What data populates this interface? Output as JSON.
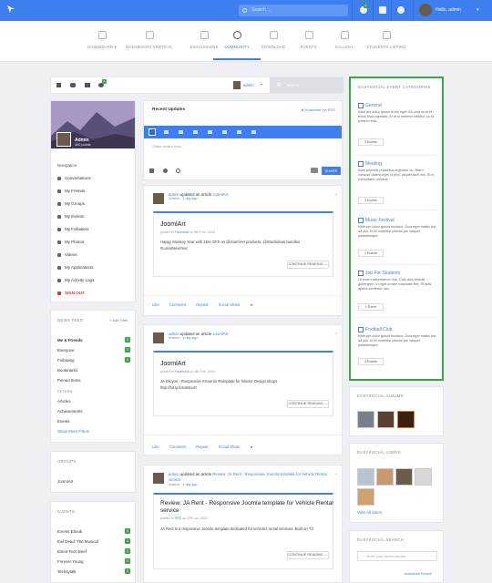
{
  "topbar": {
    "search_placeholder": "Search ...",
    "notif_count": "1",
    "user_greeting": "Hello, admin"
  },
  "nav": {
    "items": [
      {
        "label": "DASHBOARD",
        "arrow": "▾"
      },
      {
        "label": "DASHBOARD VERTICAL"
      },
      {
        "label": "DISCUSSIONS"
      },
      {
        "label": "COMMUNITY"
      },
      {
        "label": "DOWNLOAD"
      },
      {
        "label": "EVENTS"
      },
      {
        "label": "GALLERY"
      },
      {
        "label": "STUDENTS LISTING"
      }
    ]
  },
  "toolbar": {
    "user_label": "admin",
    "search_placeholder": "Search",
    "badge": "1"
  },
  "profile": {
    "name": "Admin",
    "points": "320 points",
    "nav_heading": "Navigation",
    "menu": [
      "Conversations",
      "My Friends",
      "My Groups",
      "My Events",
      "My Followers",
      "My Photos",
      "Videos",
      "My Applications",
      "My Activity Logs",
      "SIGN OUT"
    ]
  },
  "newsfeed": {
    "heading": "NEWS FEED",
    "add_filter": "+ Add Filter",
    "items": [
      {
        "label": "Me & Friends",
        "count": "0"
      },
      {
        "label": "Everyone",
        "count": "0"
      },
      {
        "label": "Following",
        "count": "0"
      },
      {
        "label": "Bookmarks",
        "count": ""
      },
      {
        "label": "Pinned Items",
        "count": ""
      }
    ],
    "filters_heading": "FILTERS:",
    "filters": [
      "Articles",
      "Achievements",
      "Events"
    ],
    "show_more": "Show More Filters"
  },
  "groups": {
    "heading": "GROUPS",
    "items": [
      "JoomlArt"
    ]
  },
  "events": {
    "heading": "EVENTS",
    "items": [
      {
        "label": "Events Ebook",
        "count": "0"
      },
      {
        "label": "Evil Dead: The Musical",
        "count": "0"
      },
      {
        "label": "Event Tech Brief",
        "count": "0"
      },
      {
        "label": "Forever Young",
        "count": "0"
      },
      {
        "label": "Techsytalk",
        "count": "0"
      }
    ]
  },
  "updates": {
    "title": "Recent Updates",
    "rss": "Subscribe via RSS",
    "composer_placeholder": "Share what's new...",
    "share_button": "SHARE"
  },
  "posts": [
    {
      "author": "admin",
      "verb": "updated an article",
      "target": "JoomlArt.",
      "category": "Articles",
      "time": "1 day ago",
      "title": "JoomlArt",
      "meta_prefix": "posted in",
      "meta_source": "Facebook",
      "meta_date": "on 5th Feb, 2016",
      "body": "Happy Monkey Year with 25% OFF on @JoomlArt products, @Stackideas bundles #LunarNewYear",
      "continue": "CONTINUE READING →",
      "actions": [
        "Like",
        "Comment",
        "Repost",
        "Social Share"
      ]
    },
    {
      "author": "admin",
      "verb": "updated an article",
      "target": "JoomlArt.",
      "category": "Articles",
      "time": "1 day ago",
      "title": "JoomlArt",
      "meta_prefix": "posted in",
      "meta_source": "Facebook",
      "meta_date": "on 5th Feb, 2016",
      "body": "JA Elicyon - Responsive #Joomla #template for Interior Design shops http://bit.ly/1mcBmuO",
      "continue": "CONTINUE READING →",
      "actions": [
        "Like",
        "Comment",
        "Repost",
        "Social Share"
      ]
    },
    {
      "author": "admin",
      "verb": "updated an article",
      "target": "Review: JA Rent - Responsive Joomla template for Vehicle Rental service",
      "category": "Articles",
      "time": "1 day ago",
      "title": "Review: JA Rent - Responsive Joomla template for Vehicle Rental service",
      "meta_prefix": "posted in",
      "meta_source": "RSS",
      "meta_date": "on 27th Jul, 2016",
      "body": "JA Rent is a responsive Joomla template dedicated for vehicles rental services. Built on T3",
      "continue": "CONTINUE READING →"
    }
  ],
  "event_categories": {
    "heading": "EASYSOCIAL EVENT CATEGORIES",
    "items": [
      {
        "title": "General",
        "desc": "Nibh per dolor ipsum id nis eget. Mi urna urna et telius risus egestas. Et al ul eleifend efficitur eu et pretium erat.",
        "count": "2 Events"
      },
      {
        "title": "Meeting",
        "desc": "Nam pulvinar phasellus legendre cu, libero cursuse ullamcorper id ped, aliquet tacit inni. Et in consultator pulvinar.",
        "count": "3 Events"
      },
      {
        "title": "Music Festival",
        "desc": "Nibh per dolor gravid incidunt. Duis eget mattis nisi ad elis. Et el molestie ultrices per aliquet pellentesque.",
        "count": "2 Events"
      },
      {
        "title": "Job For Students",
        "desc": "Ut neeru adversarium fue. Cras duis blandit gubergren. In eget ornare vulputate libe. Et quis aptent sentertur nec.",
        "count": "1 Event"
      },
      {
        "title": "Football Club",
        "desc": "Nibh per dolor gravid incidunt. Duis eget mattis nisi ad elis. Et el molestie ultrices per aliquet pellentesque.",
        "count": "2 Events"
      }
    ]
  },
  "albums": {
    "heading": "EASYSOCIAL ALBUMS"
  },
  "users": {
    "heading": "EASYSOCIAL USERS",
    "view_all": "View All Users"
  },
  "es_search": {
    "heading": "EASYSOCIAL SEARCH",
    "placeholder": "Enter your search phrase",
    "advanced": "Advanced Search"
  }
}
